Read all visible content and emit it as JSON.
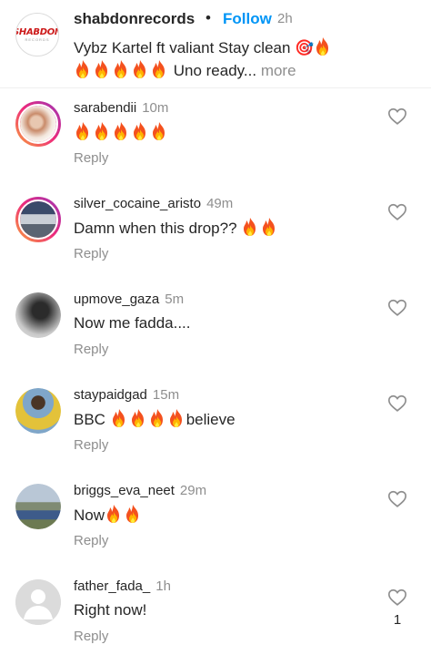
{
  "post": {
    "username": "shabdonrecords",
    "dot": "•",
    "follow_label": "Follow",
    "time": "2h",
    "caption_text": "Vybz Kartel ft valiant Stay clean",
    "caption_emoji_1": "🎯",
    "caption_more_text": "Uno ready...",
    "more_label": "more",
    "logo_text": "SHABDON",
    "logo_sub": "RECORDS"
  },
  "comments": [
    {
      "username": "sarabendii",
      "time": "10m",
      "text": "",
      "fires_after": 5,
      "reply_label": "Reply",
      "likes": ""
    },
    {
      "username": "silver_cocaine_aristo",
      "time": "49m",
      "text": "Damn when this drop?? ",
      "fires_after": 2,
      "reply_label": "Reply",
      "likes": ""
    },
    {
      "username": "upmove_gaza",
      "time": "5m",
      "text": "Now me fadda....",
      "fires_after": 0,
      "reply_label": "Reply",
      "likes": ""
    },
    {
      "username": "staypaidgad",
      "time": "15m",
      "text_before": "BBC ",
      "fires_mid": 4,
      "text_after": "believe",
      "reply_label": "Reply",
      "likes": ""
    },
    {
      "username": "briggs_eva_neet",
      "time": "29m",
      "text": "Now",
      "fires_after": 2,
      "reply_label": "Reply",
      "likes": ""
    },
    {
      "username": "father_fada_",
      "time": "1h",
      "text": "Right now!",
      "fires_after": 0,
      "reply_label": "Reply",
      "likes": "1"
    }
  ],
  "icons": {
    "like": "heart-outline-icon",
    "fire": "fire-emoji-icon",
    "target": "direct-hit-emoji-icon"
  },
  "colors": {
    "follow": "#0095f6",
    "muted": "#8e8e8e",
    "text": "#262626"
  }
}
